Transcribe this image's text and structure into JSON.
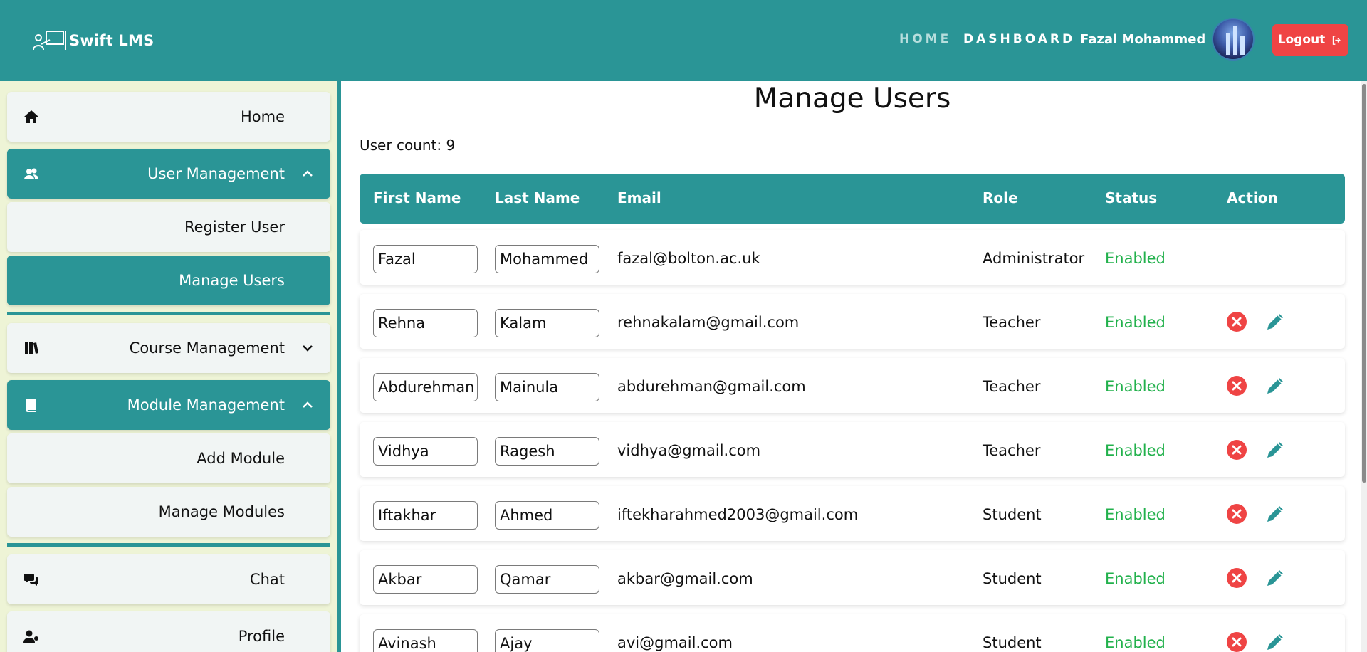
{
  "brand": {
    "name": "Swift LMS",
    "icon": "teacher-board-icon"
  },
  "nav": {
    "home": "HOME",
    "dashboard": "DASHBOARD",
    "user_name": "Fazal Mohammed",
    "logout": "Logout"
  },
  "sidebar": {
    "items": [
      {
        "label": "Home",
        "icon": "home-icon"
      },
      {
        "label": "User Management",
        "icon": "users-icon",
        "expanded": true
      },
      {
        "label": "Register User"
      },
      {
        "label": "Manage Users",
        "active": true
      },
      {
        "label": "Course Management",
        "icon": "books-icon",
        "expanded": false
      },
      {
        "label": "Module Management",
        "icon": "book-icon",
        "expanded": true
      },
      {
        "label": "Add Module"
      },
      {
        "label": "Manage Modules"
      },
      {
        "label": "Chat",
        "icon": "chat-icon"
      },
      {
        "label": "Profile",
        "icon": "user-cog-icon"
      }
    ]
  },
  "main": {
    "title": "Manage Users",
    "user_count": "User count: 9",
    "columns": [
      "First Name",
      "Last Name",
      "Email",
      "Role",
      "Status",
      "Action"
    ],
    "rows": [
      {
        "first": "Fazal",
        "last": "Mohammed",
        "email": "fazal@bolton.ac.uk",
        "role": "Administrator",
        "status": "Enabled",
        "actions": false
      },
      {
        "first": "Rehna",
        "last": "Kalam",
        "email": "rehnakalam@gmail.com",
        "role": "Teacher",
        "status": "Enabled",
        "actions": true
      },
      {
        "first": "Abdurehman",
        "last": "Mainula",
        "email": "abdurehman@gmail.com",
        "role": "Teacher",
        "status": "Enabled",
        "actions": true
      },
      {
        "first": "Vidhya",
        "last": "Ragesh",
        "email": "vidhya@gmail.com",
        "role": "Teacher",
        "status": "Enabled",
        "actions": true
      },
      {
        "first": "Iftakhar",
        "last": "Ahmed",
        "email": "iftekharahmed2003@gmail.com",
        "role": "Student",
        "status": "Enabled",
        "actions": true
      },
      {
        "first": "Akbar",
        "last": "Qamar",
        "email": "akbar@gmail.com",
        "role": "Student",
        "status": "Enabled",
        "actions": true
      },
      {
        "first": "Avinash",
        "last": "Ajay",
        "email": "avi@gmail.com",
        "role": "Student",
        "status": "Enabled",
        "actions": true
      }
    ]
  },
  "colors": {
    "teal": "#2a9596",
    "danger": "#ef4444",
    "enabled": "#22b14c",
    "sidebar_bg": "#eef4d6"
  }
}
